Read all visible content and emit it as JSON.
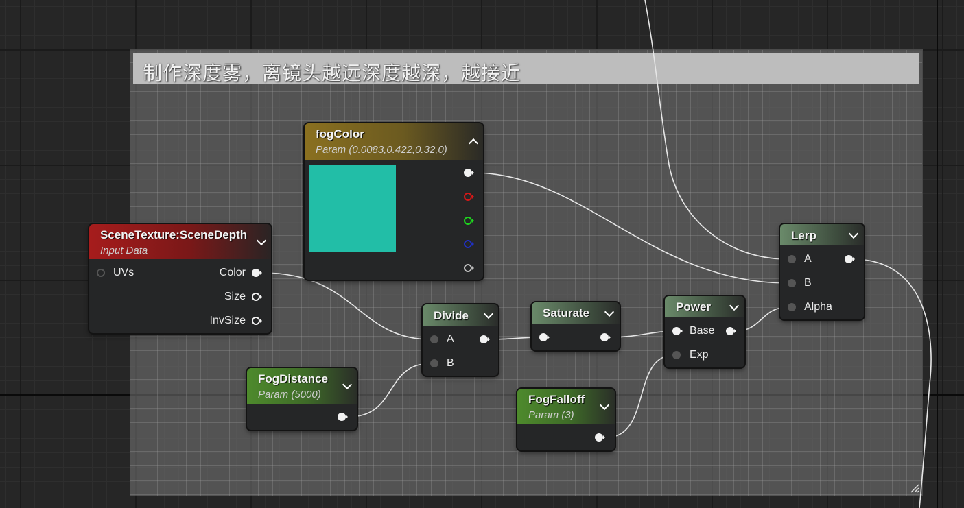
{
  "comment": {
    "title": "制作深度雾，离镜头越远深度越深，越接近"
  },
  "nodes": {
    "scene_texture": {
      "title": "SceneTexture:SceneDepth",
      "subtitle": "Input Data",
      "inputs": [
        "UVs"
      ],
      "outputs": [
        "Color",
        "Size",
        "InvSize"
      ],
      "header_color": "#a61c1c"
    },
    "fog_color": {
      "title": "fogColor",
      "subtitle": "Param (0.0083,0.422,0.32,0)",
      "header_color": "#8a7020",
      "swatch_color": "#22bea7"
    },
    "divide": {
      "title": "Divide",
      "inputs": [
        "A",
        "B"
      ],
      "header_color": "#5c7a5c"
    },
    "saturate": {
      "title": "Saturate",
      "header_color": "#5c7a5c"
    },
    "power": {
      "title": "Power",
      "inputs": [
        "Base",
        "Exp"
      ],
      "header_color": "#5c7a5c"
    },
    "lerp": {
      "title": "Lerp",
      "inputs": [
        "A",
        "B",
        "Alpha"
      ],
      "header_color": "#5c7a5c"
    },
    "fog_distance": {
      "title": "FogDistance",
      "subtitle": "Param (5000)",
      "header_color": "#4e8a2c"
    },
    "fog_falloff": {
      "title": "FogFalloff",
      "subtitle": "Param (3)",
      "header_color": "#4e8a2c"
    }
  }
}
